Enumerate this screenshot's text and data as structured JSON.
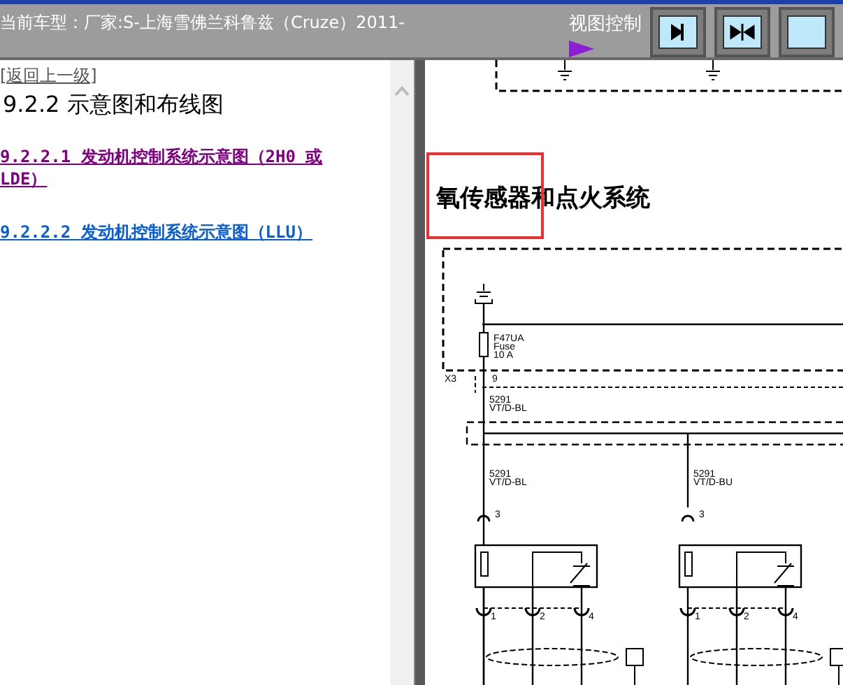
{
  "header": {
    "vehicle": "当前车型：厂家:S-上海雪佛兰科鲁兹（Cruze）2011-",
    "view_control": "视图控制"
  },
  "nav": {
    "back_link": "[返回上一级]",
    "heading": "9.2.2 示意图和布线图",
    "links": [
      {
        "label": "9.2.2.1 发动机控制系统示意图（2H0 或 LDE）",
        "visited": true
      },
      {
        "label": "9.2.2.2 发动机控制系统示意图（LLU）",
        "visited": false
      }
    ]
  },
  "diagram": {
    "title": "氧传感器和点火系统",
    "labels": [
      "F47UA",
      "Fuse",
      "10 A",
      "X3",
      "9",
      "5291",
      "VT/D-BL",
      "5291",
      "VT/D-BL",
      "3",
      "5291",
      "VT/D-BU",
      "3",
      "1",
      "2",
      "4",
      "1",
      "2",
      "4"
    ]
  }
}
